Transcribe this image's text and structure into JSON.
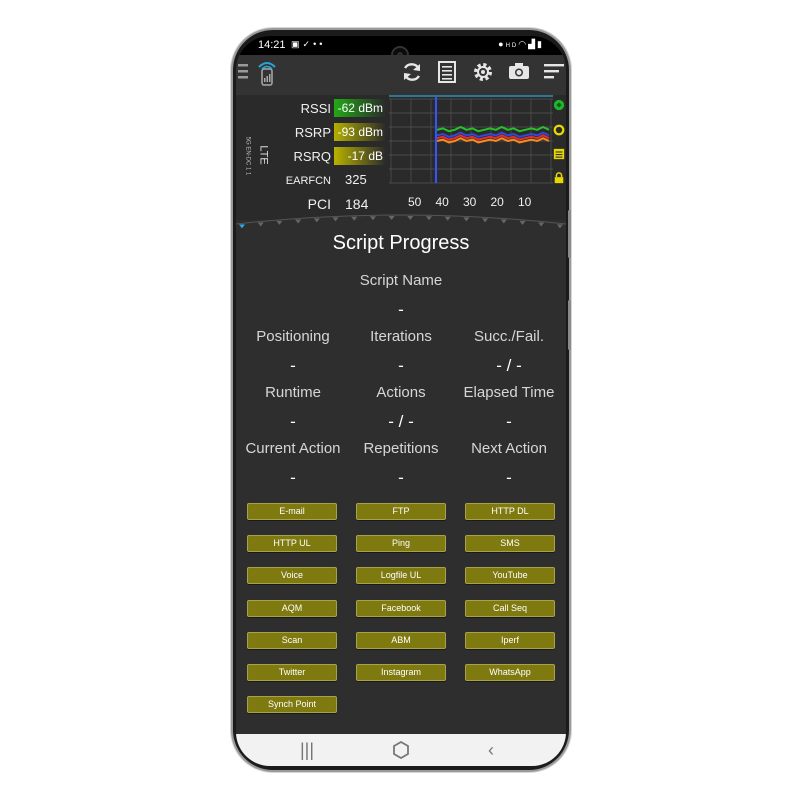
{
  "status_bar": {
    "time": "14:21",
    "left_icons": [
      "gallery-icon",
      "check-icon",
      "location-pin-icon",
      "dot-icon"
    ],
    "right_icons": [
      "location-icon",
      "hd-icon",
      "wifi-icon",
      "signal-icon",
      "battery-icon"
    ]
  },
  "toolbar": {
    "icons": [
      "menu-icon",
      "app-logo-icon",
      "refresh-icon",
      "list-icon",
      "settings-icon",
      "camera-icon",
      "sort-icon"
    ]
  },
  "network": {
    "tech": "LTE",
    "sub": "5G EN-DC 1 1",
    "rssi_label": "RSSI",
    "rssi_value": "-62 dBm",
    "rsrp_label": "RSRP",
    "rsrp_value": "-93 dBm",
    "rsrq_label": "RSRQ",
    "rsrq_value": "-17 dB",
    "earfcn_label": "EARFCN",
    "earfcn_value": "325",
    "pci_label": "PCI",
    "pci_value": "184",
    "colors": {
      "rssi": "#22a817",
      "rsrp": "#b3b000",
      "rsrq": "#b7b200"
    }
  },
  "chart_data": {
    "type": "line",
    "x_ticks": [
      "50",
      "40",
      "30",
      "20",
      "10"
    ],
    "series": [
      {
        "color": "#27c12a",
        "values": [
          -62,
          -61,
          -63,
          -62,
          -60,
          -62,
          -61,
          -63,
          -62,
          -61,
          -62,
          -60,
          -62,
          -61,
          -63,
          -62,
          -61,
          -62,
          -60,
          -62
        ]
      },
      {
        "color": "#2f49d8",
        "values": [
          -66,
          -65,
          -67,
          -66,
          -64,
          -66,
          -65,
          -67,
          -66,
          -65,
          -66,
          -64,
          -66,
          -65,
          -67,
          -66,
          -65,
          -66,
          -64,
          -66
        ]
      },
      {
        "color": "#ff8a1c",
        "values": [
          -70,
          -69,
          -71,
          -70,
          -68,
          -70,
          -69,
          -71,
          -70,
          -69,
          -70,
          -68,
          -70,
          -69,
          -71,
          -70,
          -69,
          -70,
          -68,
          -70
        ]
      },
      {
        "color": "#e03030",
        "values": [
          -68,
          -67,
          -69,
          -68,
          -66,
          -68,
          -67,
          -69,
          -68,
          -67,
          -68,
          -66,
          -68,
          -67,
          -69,
          -68,
          -67,
          -68,
          -66,
          -68
        ]
      }
    ],
    "grid": true
  },
  "script_progress": {
    "title": "Script Progress",
    "script_name_label": "Script Name",
    "script_name_value": "-",
    "positioning_label": "Positioning",
    "positioning_value": "-",
    "iterations_label": "Iterations",
    "iterations_value": "-",
    "succfail_label": "Succ./Fail.",
    "succfail_value": "- / -",
    "runtime_label": "Runtime",
    "runtime_value": "-",
    "actions_label": "Actions",
    "actions_value": "- / -",
    "elapsed_label": "Elapsed Time",
    "elapsed_value": "-",
    "current_action_label": "Current Action",
    "current_action_value": "-",
    "repetitions_label": "Repetitions",
    "repetitions_value": "-",
    "next_action_label": "Next Action",
    "next_action_value": "-"
  },
  "action_buttons": [
    "E-mail",
    "FTP",
    "HTTP DL",
    "HTTP UL",
    "Ping",
    "SMS",
    "Voice",
    "Logfile UL",
    "YouTube",
    "AQM",
    "Facebook",
    "Call Seq",
    "Scan",
    "ABM",
    "Iperf",
    "Twitter",
    "Instagram",
    "WhatsApp",
    "Synch Point"
  ],
  "nav": {
    "icons": [
      "recent-apps-icon",
      "home-icon",
      "back-icon"
    ]
  }
}
